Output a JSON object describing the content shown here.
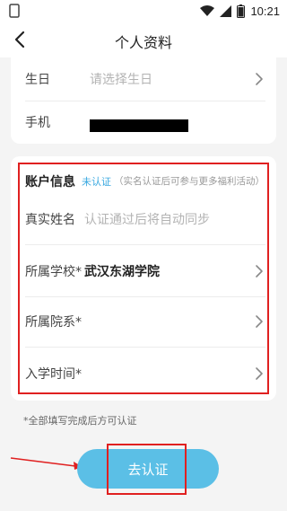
{
  "status_bar": {
    "time": "10:21"
  },
  "nav": {
    "title": "个人资料"
  },
  "basic": {
    "birthday": {
      "label": "生日",
      "placeholder": "请选择生日"
    },
    "phone": {
      "label": "手机"
    }
  },
  "account": {
    "title": "账户信息",
    "status": "未认证",
    "note": "（实名认证后可参与更多福利活动）",
    "fields": [
      {
        "label": "真实姓名",
        "placeholder": "认证通过后将自动同步"
      },
      {
        "label": "所属学校*",
        "value": "武汉东湖学院"
      },
      {
        "label": "所属院系*"
      },
      {
        "label": "入学时间*"
      }
    ]
  },
  "footnote": "*全部填写完成后方可认证",
  "submit": {
    "label": "去认证"
  },
  "colors": {
    "accent": "#38a8e0",
    "button": "#5bbfe6",
    "highlight": "#e02020"
  }
}
